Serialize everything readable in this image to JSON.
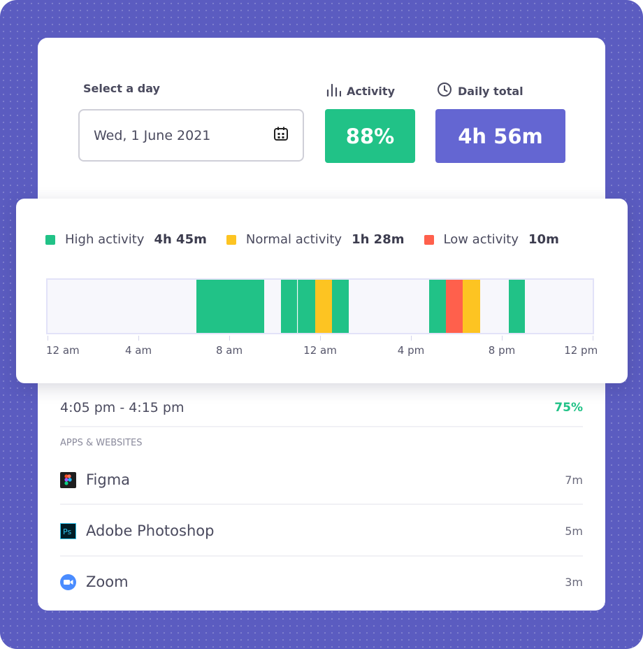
{
  "select_day": {
    "label": "Select a day",
    "value": "Wed, 1 June 2021",
    "icon": "calendar-icon"
  },
  "activity": {
    "label": "Activity",
    "value": "88%",
    "color": "#21c287",
    "icon": "bar-chart-icon"
  },
  "daily_total": {
    "label": "Daily total",
    "value": "4h 56m",
    "color": "#6466d2",
    "icon": "clock-icon"
  },
  "legend": [
    {
      "label": "High activity",
      "value": "4h 45m",
      "color": "#21c287"
    },
    {
      "label": "Normal activity",
      "value": "1h 28m",
      "color": "#fdc422"
    },
    {
      "label": "Low activity",
      "value": "10m",
      "color": "#ff604c"
    }
  ],
  "timeline": {
    "range_hours": [
      0,
      24
    ],
    "ticks": [
      {
        "label": "12 am",
        "hour": 0
      },
      {
        "label": "4 am",
        "hour": 4
      },
      {
        "label": "8 am",
        "hour": 8
      },
      {
        "label": "12 am",
        "hour": 12
      },
      {
        "label": "4 pm",
        "hour": 16
      },
      {
        "label": "8 pm",
        "hour": 20
      },
      {
        "label": "12 pm",
        "hour": 24
      }
    ],
    "segments": [
      {
        "start": 6.55,
        "end": 9.55,
        "level": "high"
      },
      {
        "start": 10.28,
        "end": 11.0,
        "level": "high"
      },
      {
        "start": 11.0,
        "end": 11.78,
        "level": "high"
      },
      {
        "start": 11.78,
        "end": 12.52,
        "level": "normal"
      },
      {
        "start": 12.52,
        "end": 13.25,
        "level": "high"
      },
      {
        "start": 16.8,
        "end": 17.53,
        "level": "high"
      },
      {
        "start": 17.53,
        "end": 18.27,
        "level": "low"
      },
      {
        "start": 18.27,
        "end": 19.04,
        "level": "normal"
      },
      {
        "start": 20.3,
        "end": 21.03,
        "level": "high"
      }
    ]
  },
  "detail": {
    "time_range": "4:05 pm - 4:15 pm",
    "percent": "75%",
    "percent_color": "#21c287",
    "section_title": "APPS & WEBSITES",
    "apps": [
      {
        "name": "Figma",
        "duration": "7m",
        "icon": "figma-icon"
      },
      {
        "name": "Adobe Photoshop",
        "duration": "5m",
        "icon": "photoshop-icon"
      },
      {
        "name": "Zoom",
        "duration": "3m",
        "icon": "zoom-icon"
      }
    ]
  }
}
